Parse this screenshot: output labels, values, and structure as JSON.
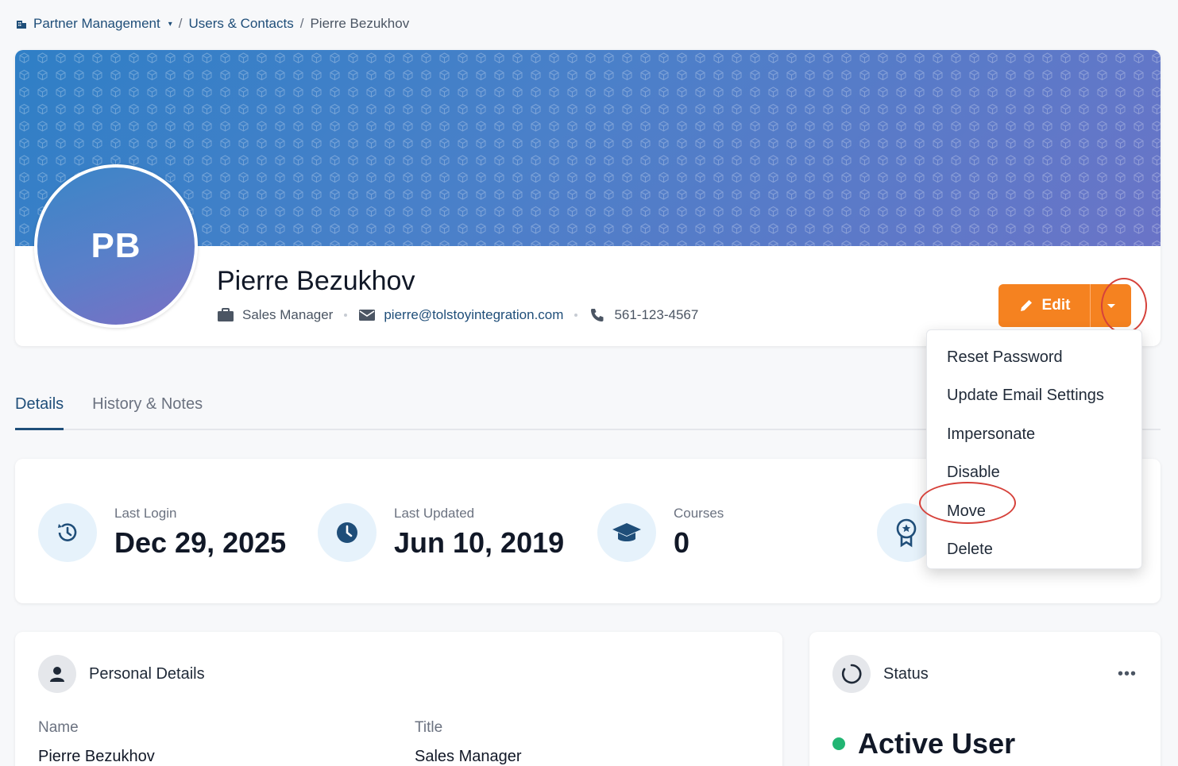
{
  "breadcrumb": {
    "root": "Partner Management",
    "middle": "Users & Contacts",
    "current": "Pierre Bezukhov"
  },
  "profile": {
    "initials": "PB",
    "name": "Pierre Bezukhov",
    "job_title": "Sales Manager",
    "email": "pierre@tolstoyintegration.com",
    "phone": "561-123-4567"
  },
  "actions": {
    "edit_label": "Edit",
    "menu": [
      "Reset Password",
      "Update Email Settings",
      "Impersonate",
      "Disable",
      "Move",
      "Delete"
    ]
  },
  "tabs": [
    "Details",
    "History & Notes"
  ],
  "stats": [
    {
      "label": "Last Login",
      "value": "Dec 29, 2025",
      "icon": "history-icon"
    },
    {
      "label": "Last Updated",
      "value": "Jun 10, 2019",
      "icon": "clock-icon"
    },
    {
      "label": "Courses",
      "value": "0",
      "icon": "graduation-cap-icon"
    },
    {
      "icon": "award-ribbon-icon"
    }
  ],
  "personal": {
    "heading": "Personal Details",
    "fields": [
      {
        "label": "Name",
        "value": "Pierre Bezukhov"
      },
      {
        "label": "Title",
        "value": "Sales Manager"
      }
    ]
  },
  "status": {
    "heading": "Status",
    "more": "•••",
    "value": "Active User",
    "dot_color": "#22b573"
  },
  "colors": {
    "accent": "#f58220",
    "link": "#1f4e79",
    "highlight": "#d6423b"
  }
}
